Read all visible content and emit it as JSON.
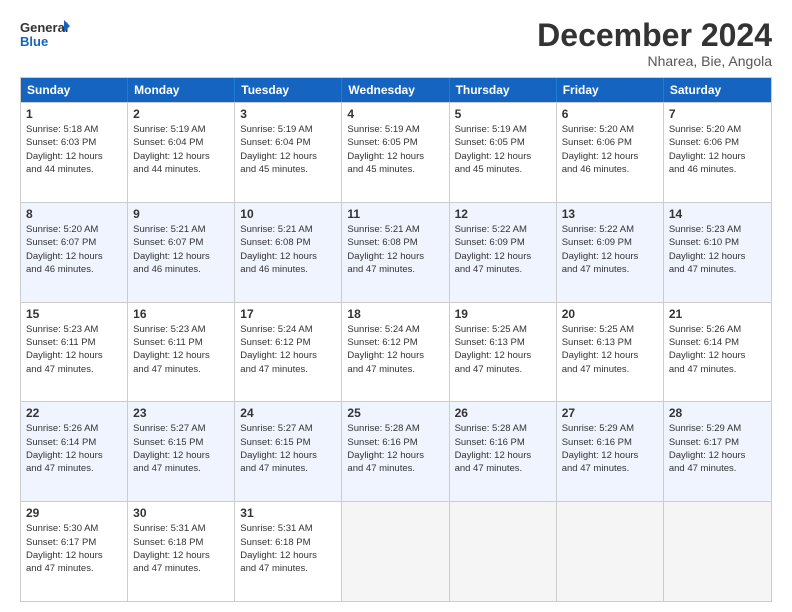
{
  "logo": {
    "line1": "General",
    "line2": "Blue"
  },
  "title": "December 2024",
  "subtitle": "Nharea, Bie, Angola",
  "headers": [
    "Sunday",
    "Monday",
    "Tuesday",
    "Wednesday",
    "Thursday",
    "Friday",
    "Saturday"
  ],
  "weeks": [
    {
      "alt": false,
      "days": [
        {
          "num": "1",
          "info": "Sunrise: 5:18 AM\nSunset: 6:03 PM\nDaylight: 12 hours\nand 44 minutes."
        },
        {
          "num": "2",
          "info": "Sunrise: 5:19 AM\nSunset: 6:04 PM\nDaylight: 12 hours\nand 44 minutes."
        },
        {
          "num": "3",
          "info": "Sunrise: 5:19 AM\nSunset: 6:04 PM\nDaylight: 12 hours\nand 45 minutes."
        },
        {
          "num": "4",
          "info": "Sunrise: 5:19 AM\nSunset: 6:05 PM\nDaylight: 12 hours\nand 45 minutes."
        },
        {
          "num": "5",
          "info": "Sunrise: 5:19 AM\nSunset: 6:05 PM\nDaylight: 12 hours\nand 45 minutes."
        },
        {
          "num": "6",
          "info": "Sunrise: 5:20 AM\nSunset: 6:06 PM\nDaylight: 12 hours\nand 46 minutes."
        },
        {
          "num": "7",
          "info": "Sunrise: 5:20 AM\nSunset: 6:06 PM\nDaylight: 12 hours\nand 46 minutes."
        }
      ]
    },
    {
      "alt": true,
      "days": [
        {
          "num": "8",
          "info": "Sunrise: 5:20 AM\nSunset: 6:07 PM\nDaylight: 12 hours\nand 46 minutes."
        },
        {
          "num": "9",
          "info": "Sunrise: 5:21 AM\nSunset: 6:07 PM\nDaylight: 12 hours\nand 46 minutes."
        },
        {
          "num": "10",
          "info": "Sunrise: 5:21 AM\nSunset: 6:08 PM\nDaylight: 12 hours\nand 46 minutes."
        },
        {
          "num": "11",
          "info": "Sunrise: 5:21 AM\nSunset: 6:08 PM\nDaylight: 12 hours\nand 47 minutes."
        },
        {
          "num": "12",
          "info": "Sunrise: 5:22 AM\nSunset: 6:09 PM\nDaylight: 12 hours\nand 47 minutes."
        },
        {
          "num": "13",
          "info": "Sunrise: 5:22 AM\nSunset: 6:09 PM\nDaylight: 12 hours\nand 47 minutes."
        },
        {
          "num": "14",
          "info": "Sunrise: 5:23 AM\nSunset: 6:10 PM\nDaylight: 12 hours\nand 47 minutes."
        }
      ]
    },
    {
      "alt": false,
      "days": [
        {
          "num": "15",
          "info": "Sunrise: 5:23 AM\nSunset: 6:11 PM\nDaylight: 12 hours\nand 47 minutes."
        },
        {
          "num": "16",
          "info": "Sunrise: 5:23 AM\nSunset: 6:11 PM\nDaylight: 12 hours\nand 47 minutes."
        },
        {
          "num": "17",
          "info": "Sunrise: 5:24 AM\nSunset: 6:12 PM\nDaylight: 12 hours\nand 47 minutes."
        },
        {
          "num": "18",
          "info": "Sunrise: 5:24 AM\nSunset: 6:12 PM\nDaylight: 12 hours\nand 47 minutes."
        },
        {
          "num": "19",
          "info": "Sunrise: 5:25 AM\nSunset: 6:13 PM\nDaylight: 12 hours\nand 47 minutes."
        },
        {
          "num": "20",
          "info": "Sunrise: 5:25 AM\nSunset: 6:13 PM\nDaylight: 12 hours\nand 47 minutes."
        },
        {
          "num": "21",
          "info": "Sunrise: 5:26 AM\nSunset: 6:14 PM\nDaylight: 12 hours\nand 47 minutes."
        }
      ]
    },
    {
      "alt": true,
      "days": [
        {
          "num": "22",
          "info": "Sunrise: 5:26 AM\nSunset: 6:14 PM\nDaylight: 12 hours\nand 47 minutes."
        },
        {
          "num": "23",
          "info": "Sunrise: 5:27 AM\nSunset: 6:15 PM\nDaylight: 12 hours\nand 47 minutes."
        },
        {
          "num": "24",
          "info": "Sunrise: 5:27 AM\nSunset: 6:15 PM\nDaylight: 12 hours\nand 47 minutes."
        },
        {
          "num": "25",
          "info": "Sunrise: 5:28 AM\nSunset: 6:16 PM\nDaylight: 12 hours\nand 47 minutes."
        },
        {
          "num": "26",
          "info": "Sunrise: 5:28 AM\nSunset: 6:16 PM\nDaylight: 12 hours\nand 47 minutes."
        },
        {
          "num": "27",
          "info": "Sunrise: 5:29 AM\nSunset: 6:16 PM\nDaylight: 12 hours\nand 47 minutes."
        },
        {
          "num": "28",
          "info": "Sunrise: 5:29 AM\nSunset: 6:17 PM\nDaylight: 12 hours\nand 47 minutes."
        }
      ]
    },
    {
      "alt": false,
      "days": [
        {
          "num": "29",
          "info": "Sunrise: 5:30 AM\nSunset: 6:17 PM\nDaylight: 12 hours\nand 47 minutes."
        },
        {
          "num": "30",
          "info": "Sunrise: 5:31 AM\nSunset: 6:18 PM\nDaylight: 12 hours\nand 47 minutes."
        },
        {
          "num": "31",
          "info": "Sunrise: 5:31 AM\nSunset: 6:18 PM\nDaylight: 12 hours\nand 47 minutes."
        },
        {
          "num": "",
          "info": ""
        },
        {
          "num": "",
          "info": ""
        },
        {
          "num": "",
          "info": ""
        },
        {
          "num": "",
          "info": ""
        }
      ]
    }
  ]
}
